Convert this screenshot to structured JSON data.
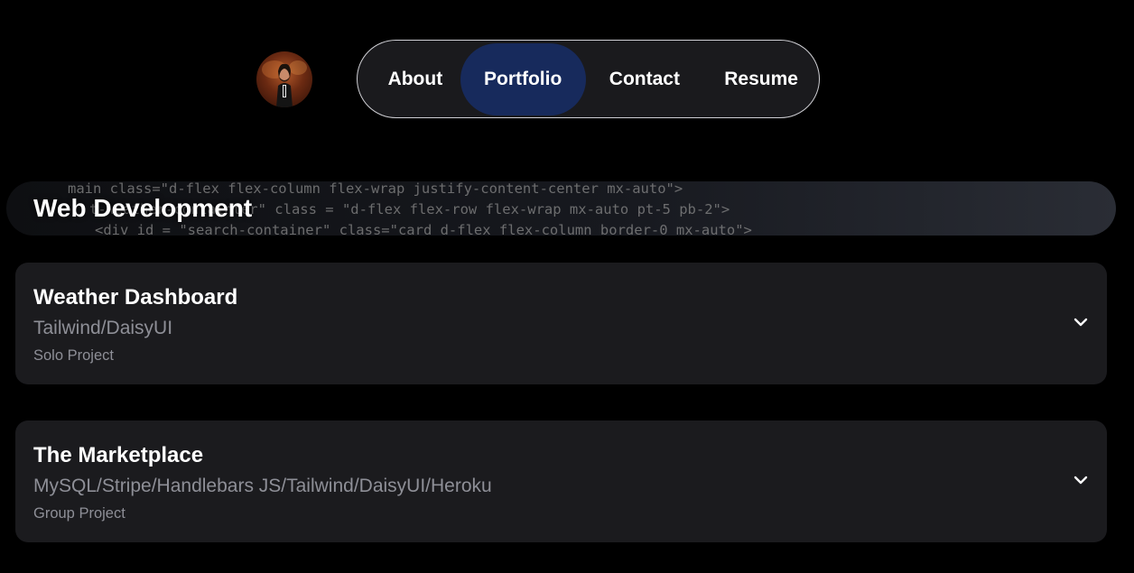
{
  "header": {
    "avatar_alt": "Profile photo"
  },
  "nav": {
    "items": [
      {
        "label": "About"
      },
      {
        "label": "Portfolio",
        "active": true
      },
      {
        "label": "Contact"
      },
      {
        "label": "Resume"
      }
    ],
    "active_color": "#172a5c"
  },
  "section": {
    "title": "Web Development",
    "code_lines": [
      "main class=\"d-flex flex-column flex-wrap justify-content-center mx-auto\">",
      "t-weather-containter\" class = \"d-flex flex-row flex-wrap mx-auto pt-5 pb-2\">",
      "<div id = \"search-container\" class=\"card d-flex flex-column border-0 mx-auto\">"
    ]
  },
  "projects": [
    {
      "title": "Weather Dashboard",
      "stack": "Tailwind/DaisyUI",
      "type": "Solo Project",
      "expand_icon": "chevron-down-icon"
    },
    {
      "title": "The Marketplace",
      "stack": "MySQL/Stripe/Handlebars JS/Tailwind/DaisyUI/Heroku",
      "type": "Group Project",
      "expand_icon": "chevron-down-icon"
    }
  ]
}
